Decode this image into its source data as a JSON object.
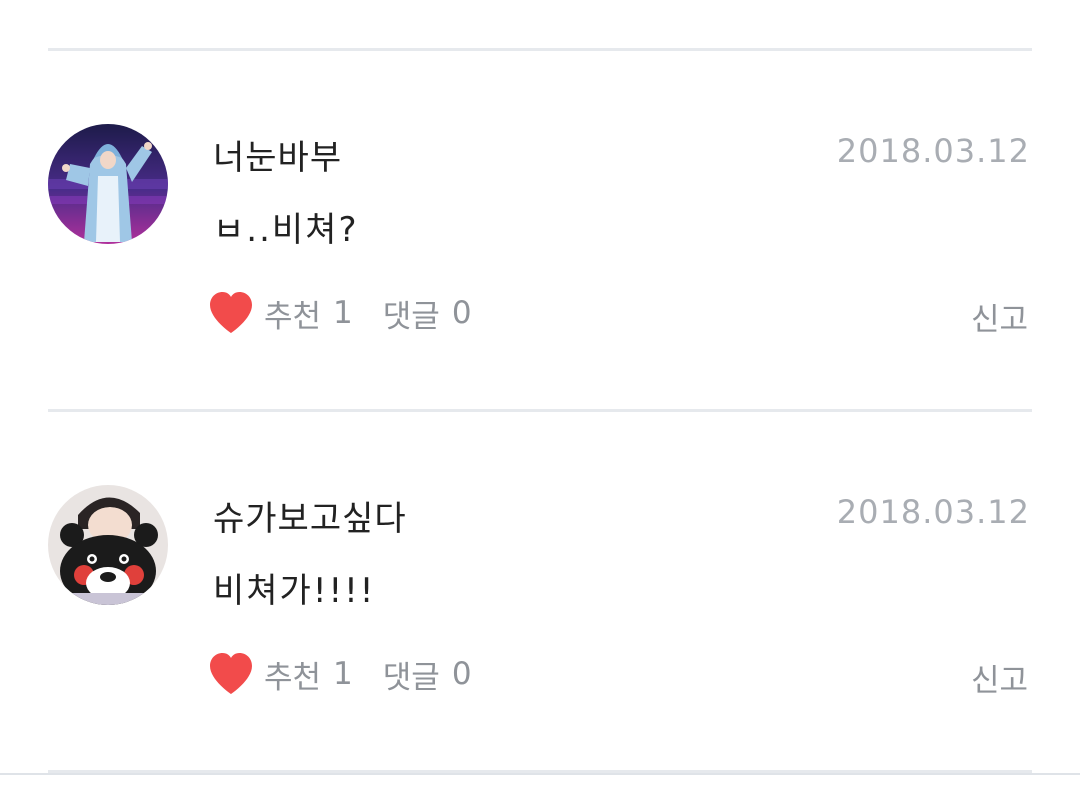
{
  "comments": [
    {
      "username": "너눈바부",
      "date": "2018.03.12",
      "text": "ㅂ..비쳐?",
      "like_label": "추천",
      "like_count": "1",
      "reply_label": "댓글",
      "reply_count": "0",
      "report_label": "신고",
      "avatar_icon": "avatar-shark-costume"
    },
    {
      "username": "슈가보고싶다",
      "date": "2018.03.12",
      "text": "비쳐가!!!!",
      "like_label": "추천",
      "like_count": "1",
      "reply_label": "댓글",
      "reply_count": "0",
      "report_label": "신고",
      "avatar_icon": "avatar-bear-plush"
    }
  ],
  "colors": {
    "heart": "#f24b4b",
    "username": "#222222",
    "meta": "#a9adb3",
    "action": "#8f9399",
    "divider": "#e6e9ed"
  }
}
